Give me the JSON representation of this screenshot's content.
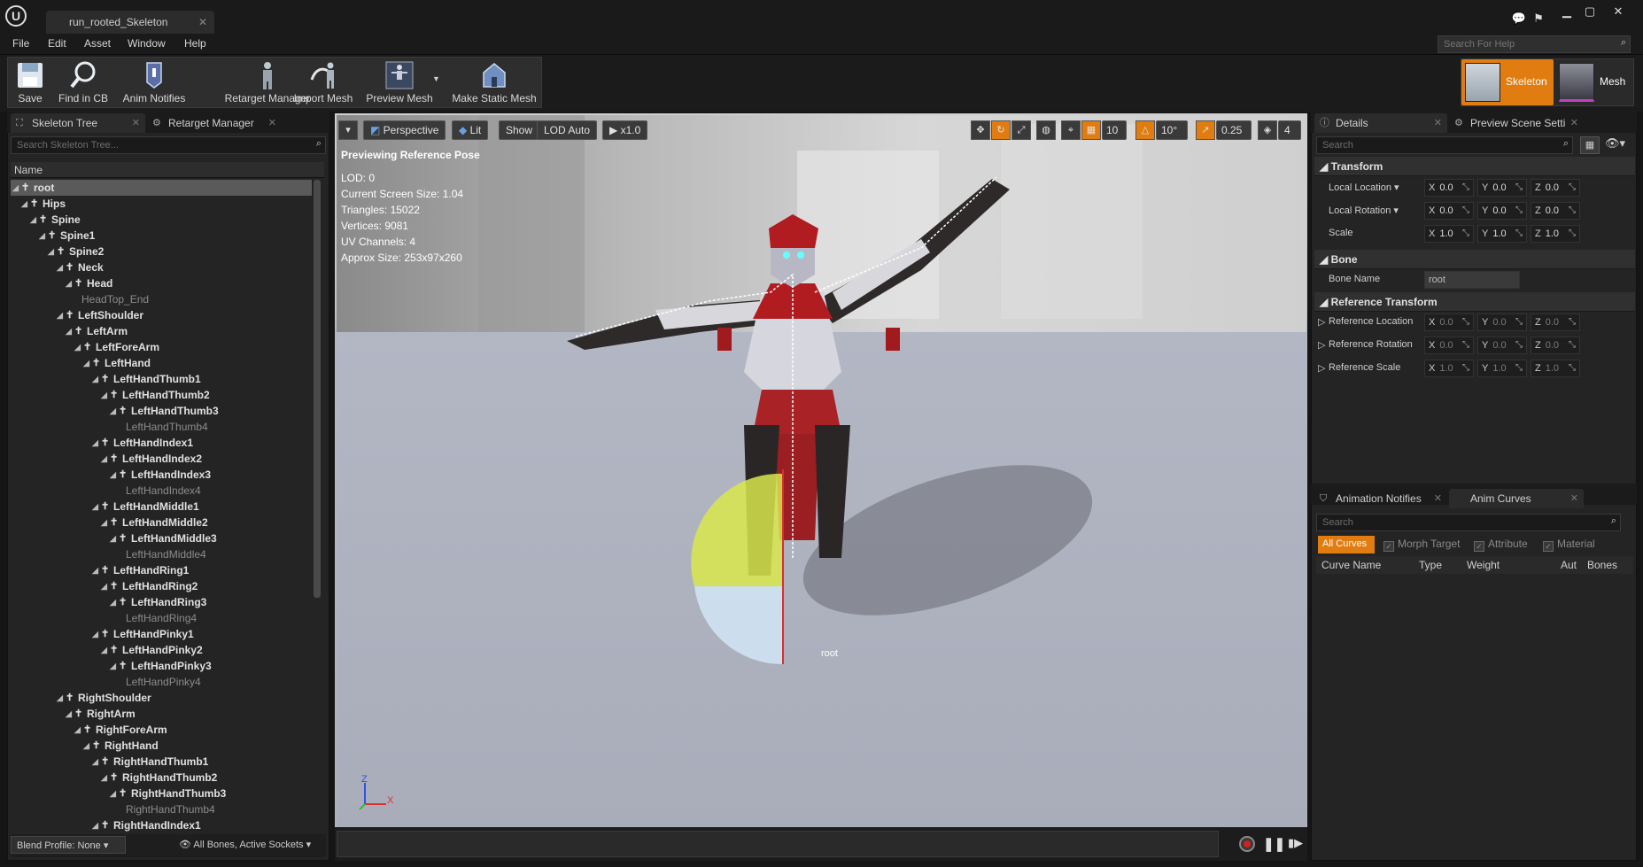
{
  "window": {
    "doc_tab": "run_rooted_Skeleton"
  },
  "menu": [
    "File",
    "Edit",
    "Asset",
    "Window",
    "Help"
  ],
  "help_search_placeholder": "Search For Help",
  "toolbar": [
    {
      "label": "Save",
      "icon": "save-icon"
    },
    {
      "label": "Find in CB",
      "icon": "find-in-cb-icon"
    },
    {
      "label": "Anim Notifies",
      "icon": "anim-notifies-icon"
    },
    {
      "label": "Retarget Manager",
      "icon": "retarget-manager-icon"
    },
    {
      "label": "Import Mesh",
      "icon": "import-mesh-icon"
    },
    {
      "label": "Preview Mesh",
      "icon": "preview-mesh-icon"
    },
    {
      "label": "Make Static Mesh",
      "icon": "make-static-mesh-icon"
    }
  ],
  "modes": {
    "skeleton": "Skeleton",
    "mesh": "Mesh"
  },
  "skeleton_tree": {
    "tabs": [
      "Skeleton Tree",
      "Retarget Manager"
    ],
    "search_placeholder": "Search Skeleton Tree...",
    "column": "Name",
    "rows": [
      {
        "name": "root",
        "depth": 0,
        "leaf": false,
        "selected": true
      },
      {
        "name": "Hips",
        "depth": 1,
        "leaf": false
      },
      {
        "name": "Spine",
        "depth": 2,
        "leaf": false
      },
      {
        "name": "Spine1",
        "depth": 3,
        "leaf": false
      },
      {
        "name": "Spine2",
        "depth": 4,
        "leaf": false
      },
      {
        "name": "Neck",
        "depth": 5,
        "leaf": false
      },
      {
        "name": "Head",
        "depth": 6,
        "leaf": false
      },
      {
        "name": "HeadTop_End",
        "depth": 7,
        "leaf": true
      },
      {
        "name": "LeftShoulder",
        "depth": 5,
        "leaf": false
      },
      {
        "name": "LeftArm",
        "depth": 6,
        "leaf": false
      },
      {
        "name": "LeftForeArm",
        "depth": 7,
        "leaf": false
      },
      {
        "name": "LeftHand",
        "depth": 8,
        "leaf": false
      },
      {
        "name": "LeftHandThumb1",
        "depth": 9,
        "leaf": false
      },
      {
        "name": "LeftHandThumb2",
        "depth": 10,
        "leaf": false
      },
      {
        "name": "LeftHandThumb3",
        "depth": 11,
        "leaf": false
      },
      {
        "name": "LeftHandThumb4",
        "depth": 12,
        "leaf": true
      },
      {
        "name": "LeftHandIndex1",
        "depth": 9,
        "leaf": false
      },
      {
        "name": "LeftHandIndex2",
        "depth": 10,
        "leaf": false
      },
      {
        "name": "LeftHandIndex3",
        "depth": 11,
        "leaf": false
      },
      {
        "name": "LeftHandIndex4",
        "depth": 12,
        "leaf": true
      },
      {
        "name": "LeftHandMiddle1",
        "depth": 9,
        "leaf": false
      },
      {
        "name": "LeftHandMiddle2",
        "depth": 10,
        "leaf": false
      },
      {
        "name": "LeftHandMiddle3",
        "depth": 11,
        "leaf": false
      },
      {
        "name": "LeftHandMiddle4",
        "depth": 12,
        "leaf": true
      },
      {
        "name": "LeftHandRing1",
        "depth": 9,
        "leaf": false
      },
      {
        "name": "LeftHandRing2",
        "depth": 10,
        "leaf": false
      },
      {
        "name": "LeftHandRing3",
        "depth": 11,
        "leaf": false
      },
      {
        "name": "LeftHandRing4",
        "depth": 12,
        "leaf": true
      },
      {
        "name": "LeftHandPinky1",
        "depth": 9,
        "leaf": false
      },
      {
        "name": "LeftHandPinky2",
        "depth": 10,
        "leaf": false
      },
      {
        "name": "LeftHandPinky3",
        "depth": 11,
        "leaf": false
      },
      {
        "name": "LeftHandPinky4",
        "depth": 12,
        "leaf": true
      },
      {
        "name": "RightShoulder",
        "depth": 5,
        "leaf": false
      },
      {
        "name": "RightArm",
        "depth": 6,
        "leaf": false
      },
      {
        "name": "RightForeArm",
        "depth": 7,
        "leaf": false
      },
      {
        "name": "RightHand",
        "depth": 8,
        "leaf": false
      },
      {
        "name": "RightHandThumb1",
        "depth": 9,
        "leaf": false
      },
      {
        "name": "RightHandThumb2",
        "depth": 10,
        "leaf": false
      },
      {
        "name": "RightHandThumb3",
        "depth": 11,
        "leaf": false
      },
      {
        "name": "RightHandThumb4",
        "depth": 12,
        "leaf": true
      },
      {
        "name": "RightHandIndex1",
        "depth": 9,
        "leaf": false
      }
    ],
    "blend_profile": "Blend Profile: None",
    "bones_filter": "All Bones, Active Sockets"
  },
  "viewport": {
    "buttons": {
      "perspective": "Perspective",
      "lit": "Lit",
      "show": "Show",
      "lod": "LOD Auto",
      "speed": "x1.0"
    },
    "grid_snap": "10",
    "rot_snap": "10°",
    "scale_snap": "0.25",
    "camera_speed": "4",
    "info_title": "Previewing Reference Pose",
    "info_lines": [
      "LOD: 0",
      "Current Screen Size: 1.04",
      "Triangles: 15022",
      "Vertices: 9081",
      "UV Channels: 4",
      "Approx Size: 253x97x260"
    ],
    "bone_label": "root",
    "axis_z": "Z",
    "axis_x": "X"
  },
  "details": {
    "tabs": [
      "Details",
      "Preview Scene Setti"
    ],
    "search_placeholder": "Search",
    "transform": {
      "title": "Transform",
      "rows": [
        {
          "label": "Local Location",
          "dropdown": true,
          "x": "0.0",
          "y": "0.0",
          "z": "0.0"
        },
        {
          "label": "Local Rotation",
          "dropdown": true,
          "x": "0.0",
          "y": "0.0",
          "z": "0.0"
        },
        {
          "label": "Scale",
          "dropdown": false,
          "x": "1.0",
          "y": "1.0",
          "z": "1.0"
        }
      ]
    },
    "bone": {
      "title": "Bone",
      "name_label": "Bone Name",
      "name_value": "root"
    },
    "reference": {
      "title": "Reference Transform",
      "rows": [
        {
          "label": "Reference Location",
          "x": "0.0",
          "y": "0.0",
          "z": "0.0"
        },
        {
          "label": "Reference Rotation",
          "x": "0.0",
          "y": "0.0",
          "z": "0.0"
        },
        {
          "label": "Reference Scale",
          "x": "1.0",
          "y": "1.0",
          "z": "1.0"
        }
      ]
    },
    "axis_labels": [
      "X",
      "Y",
      "Z"
    ]
  },
  "curves": {
    "tabs": [
      "Animation Notifies",
      "Anim Curves"
    ],
    "search_placeholder": "Search",
    "filters": {
      "all": "All Curves",
      "morph": "Morph Target",
      "attribute": "Attribute",
      "material": "Material"
    },
    "columns": [
      "Curve Name",
      "Type",
      "Weight",
      "Aut",
      "Bones"
    ]
  },
  "colors": {
    "accent": "#e07c10",
    "bg": "#242424"
  }
}
